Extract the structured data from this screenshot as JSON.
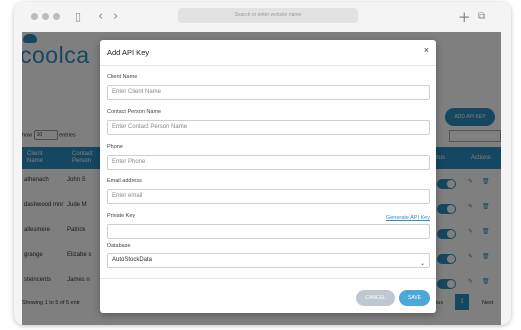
{
  "browser": {
    "url": "Search or enter website name"
  },
  "app": {
    "logo": "coolca",
    "add_button": "ADD API KEY",
    "show_label": "how",
    "show_value": "10",
    "entries_label": "entries",
    "columns": [
      "Client Name",
      "Contact Person",
      "Status",
      "Actions"
    ],
    "rows": [
      {
        "client": "athenach",
        "contact": "John S"
      },
      {
        "client": "dashwood mnr",
        "contact": "Jude M"
      },
      {
        "client": "allesmere",
        "contact": "Patrick"
      },
      {
        "client": "grange",
        "contact": "Elizabe s"
      },
      {
        "client": "steincents",
        "contact": "James n"
      }
    ],
    "footer_info": "Showing 1 to 5 of 5 entr",
    "pager_prev": "ious",
    "pager_page": "1",
    "pager_next": "Next"
  },
  "modal": {
    "title": "Add API Key",
    "close": "×",
    "fields": {
      "client_name": {
        "label": "Client Name",
        "placeholder": "Enter Client Name"
      },
      "contact_person": {
        "label": "Contact Person Name",
        "placeholder": "Enter Contact Person Name"
      },
      "phone": {
        "label": "Phone",
        "placeholder": "Enter Phone"
      },
      "email": {
        "label": "Email address",
        "placeholder": "Enter email"
      },
      "private_key": {
        "label": "Private Key",
        "value": ""
      },
      "database": {
        "label": "Database",
        "value": "AutoStockData"
      }
    },
    "generate_link": "Generate API Key",
    "cancel": "CANCEL",
    "save": "SAVE"
  },
  "colors": {
    "accent": "#2c8fc0",
    "save": "#4da7d8",
    "cancel": "#bfc8d0"
  }
}
